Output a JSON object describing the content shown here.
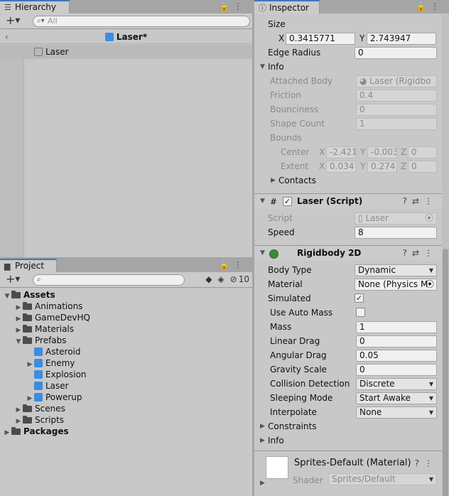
{
  "hierarchy": {
    "tab_label": "Hierarchy",
    "search_placeholder": "All",
    "scene_name": "Laser*",
    "items": [
      "Laser"
    ]
  },
  "project": {
    "tab_label": "Project",
    "hidden_count": "10",
    "tree": {
      "assets": "Assets",
      "animations": "Animations",
      "gamedevhq": "GameDevHQ",
      "materials": "Materials",
      "prefabs": "Prefabs",
      "asteroid": "Asteroid",
      "enemy": "Enemy",
      "explosion": "Explosion",
      "laser": "Laser",
      "powerup": "Powerup",
      "scenes": "Scenes",
      "scripts": "Scripts",
      "packages": "Packages"
    }
  },
  "inspector": {
    "tab_label": "Inspector",
    "size_label": "Size",
    "size_x": "0.3415771",
    "size_y": "2.743947",
    "edge_radius_label": "Edge Radius",
    "edge_radius": "0",
    "info_label": "Info",
    "attached_body_label": "Attached Body",
    "attached_body": "Laser (Rigidbo",
    "friction_label": "Friction",
    "friction": "0.4",
    "bounciness_label": "Bounciness",
    "bounciness": "0",
    "shape_count_label": "Shape Count",
    "shape_count": "1",
    "bounds_label": "Bounds",
    "center_label": "Center",
    "center_x": "-2.421",
    "center_y": "-0.003",
    "center_z": "0",
    "extent_label": "Extent",
    "extent_x": "0.034",
    "extent_y": "0.274",
    "extent_z": "0",
    "contacts_label": "Contacts",
    "laser_script": {
      "header": "Laser (Script)",
      "script_label": "Script",
      "script_value": "Laser",
      "speed_label": "Speed",
      "speed": "8"
    },
    "rigidbody": {
      "header": "Rigidbody 2D",
      "body_type_label": "Body Type",
      "body_type": "Dynamic",
      "material_label": "Material",
      "material": "None (Physics M",
      "simulated_label": "Simulated",
      "use_auto_mass_label": "Use Auto Mass",
      "mass_label": "Mass",
      "mass": "1",
      "linear_drag_label": "Linear Drag",
      "linear_drag": "0",
      "angular_drag_label": "Angular Drag",
      "angular_drag": "0.05",
      "gravity_scale_label": "Gravity Scale",
      "gravity_scale": "0",
      "collision_detection_label": "Collision Detection",
      "collision_detection": "Discrete",
      "sleeping_mode_label": "Sleeping Mode",
      "sleeping_mode": "Start Awake",
      "interpolate_label": "Interpolate",
      "interpolate": "None",
      "constraints_label": "Constraints",
      "info_label": "Info"
    },
    "material_section": {
      "title": "Sprites-Default (Material)",
      "shader_label": "Shader",
      "shader": "Sprites/Default"
    }
  },
  "axis": {
    "x": "X",
    "y": "Y",
    "z": "Z"
  },
  "colors": {
    "accent": "#3a79bb",
    "prefab_blue": "#3b8de0",
    "panel": "#c8c8c8"
  }
}
